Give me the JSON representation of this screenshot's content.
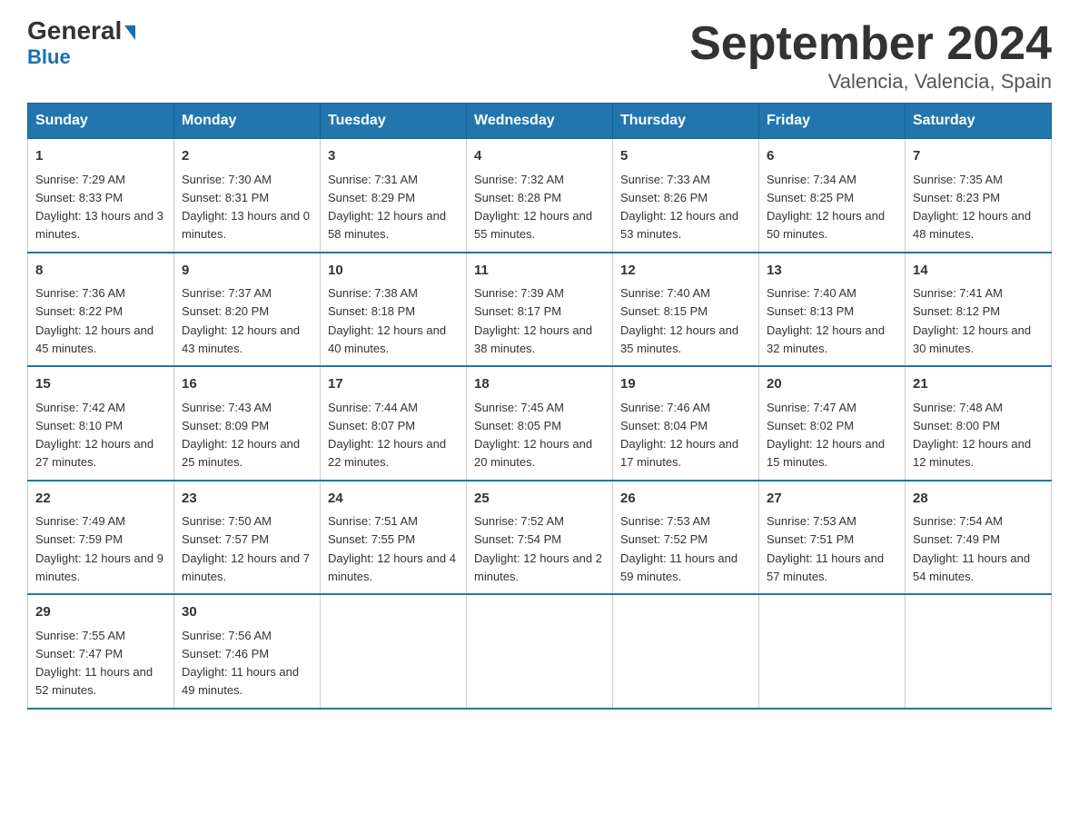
{
  "header": {
    "logo_line1_black": "General",
    "logo_line1_blue": "Blue",
    "title": "September 2024",
    "subtitle": "Valencia, Valencia, Spain"
  },
  "weekdays": [
    "Sunday",
    "Monday",
    "Tuesday",
    "Wednesday",
    "Thursday",
    "Friday",
    "Saturday"
  ],
  "weeks": [
    [
      {
        "day": "1",
        "sunrise": "7:29 AM",
        "sunset": "8:33 PM",
        "daylight": "13 hours and 3 minutes."
      },
      {
        "day": "2",
        "sunrise": "7:30 AM",
        "sunset": "8:31 PM",
        "daylight": "13 hours and 0 minutes."
      },
      {
        "day": "3",
        "sunrise": "7:31 AM",
        "sunset": "8:29 PM",
        "daylight": "12 hours and 58 minutes."
      },
      {
        "day": "4",
        "sunrise": "7:32 AM",
        "sunset": "8:28 PM",
        "daylight": "12 hours and 55 minutes."
      },
      {
        "day": "5",
        "sunrise": "7:33 AM",
        "sunset": "8:26 PM",
        "daylight": "12 hours and 53 minutes."
      },
      {
        "day": "6",
        "sunrise": "7:34 AM",
        "sunset": "8:25 PM",
        "daylight": "12 hours and 50 minutes."
      },
      {
        "day": "7",
        "sunrise": "7:35 AM",
        "sunset": "8:23 PM",
        "daylight": "12 hours and 48 minutes."
      }
    ],
    [
      {
        "day": "8",
        "sunrise": "7:36 AM",
        "sunset": "8:22 PM",
        "daylight": "12 hours and 45 minutes."
      },
      {
        "day": "9",
        "sunrise": "7:37 AM",
        "sunset": "8:20 PM",
        "daylight": "12 hours and 43 minutes."
      },
      {
        "day": "10",
        "sunrise": "7:38 AM",
        "sunset": "8:18 PM",
        "daylight": "12 hours and 40 minutes."
      },
      {
        "day": "11",
        "sunrise": "7:39 AM",
        "sunset": "8:17 PM",
        "daylight": "12 hours and 38 minutes."
      },
      {
        "day": "12",
        "sunrise": "7:40 AM",
        "sunset": "8:15 PM",
        "daylight": "12 hours and 35 minutes."
      },
      {
        "day": "13",
        "sunrise": "7:40 AM",
        "sunset": "8:13 PM",
        "daylight": "12 hours and 32 minutes."
      },
      {
        "day": "14",
        "sunrise": "7:41 AM",
        "sunset": "8:12 PM",
        "daylight": "12 hours and 30 minutes."
      }
    ],
    [
      {
        "day": "15",
        "sunrise": "7:42 AM",
        "sunset": "8:10 PM",
        "daylight": "12 hours and 27 minutes."
      },
      {
        "day": "16",
        "sunrise": "7:43 AM",
        "sunset": "8:09 PM",
        "daylight": "12 hours and 25 minutes."
      },
      {
        "day": "17",
        "sunrise": "7:44 AM",
        "sunset": "8:07 PM",
        "daylight": "12 hours and 22 minutes."
      },
      {
        "day": "18",
        "sunrise": "7:45 AM",
        "sunset": "8:05 PM",
        "daylight": "12 hours and 20 minutes."
      },
      {
        "day": "19",
        "sunrise": "7:46 AM",
        "sunset": "8:04 PM",
        "daylight": "12 hours and 17 minutes."
      },
      {
        "day": "20",
        "sunrise": "7:47 AM",
        "sunset": "8:02 PM",
        "daylight": "12 hours and 15 minutes."
      },
      {
        "day": "21",
        "sunrise": "7:48 AM",
        "sunset": "8:00 PM",
        "daylight": "12 hours and 12 minutes."
      }
    ],
    [
      {
        "day": "22",
        "sunrise": "7:49 AM",
        "sunset": "7:59 PM",
        "daylight": "12 hours and 9 minutes."
      },
      {
        "day": "23",
        "sunrise": "7:50 AM",
        "sunset": "7:57 PM",
        "daylight": "12 hours and 7 minutes."
      },
      {
        "day": "24",
        "sunrise": "7:51 AM",
        "sunset": "7:55 PM",
        "daylight": "12 hours and 4 minutes."
      },
      {
        "day": "25",
        "sunrise": "7:52 AM",
        "sunset": "7:54 PM",
        "daylight": "12 hours and 2 minutes."
      },
      {
        "day": "26",
        "sunrise": "7:53 AM",
        "sunset": "7:52 PM",
        "daylight": "11 hours and 59 minutes."
      },
      {
        "day": "27",
        "sunrise": "7:53 AM",
        "sunset": "7:51 PM",
        "daylight": "11 hours and 57 minutes."
      },
      {
        "day": "28",
        "sunrise": "7:54 AM",
        "sunset": "7:49 PM",
        "daylight": "11 hours and 54 minutes."
      }
    ],
    [
      {
        "day": "29",
        "sunrise": "7:55 AM",
        "sunset": "7:47 PM",
        "daylight": "11 hours and 52 minutes."
      },
      {
        "day": "30",
        "sunrise": "7:56 AM",
        "sunset": "7:46 PM",
        "daylight": "11 hours and 49 minutes."
      },
      null,
      null,
      null,
      null,
      null
    ]
  ]
}
